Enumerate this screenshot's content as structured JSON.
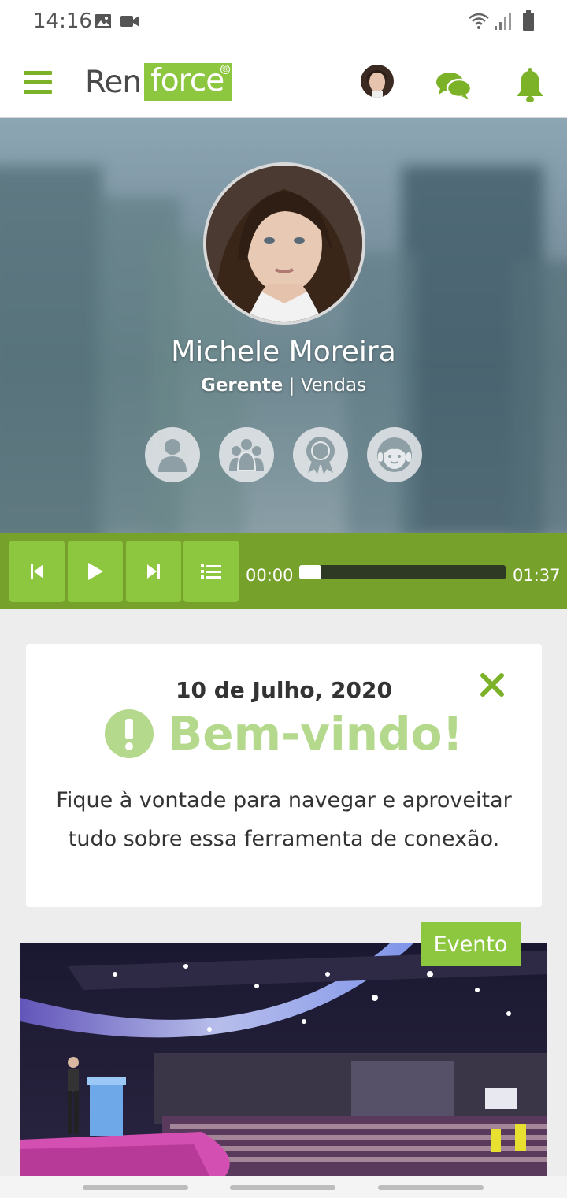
{
  "status_bar": {
    "time": "14:16",
    "icons": [
      "image-icon",
      "video-camera-icon",
      "wifi-icon",
      "signal-icon",
      "battery-icon"
    ]
  },
  "header": {
    "logo_part1": "Ren",
    "logo_part2": "force",
    "logo_mark": "®",
    "icons": [
      "menu-icon",
      "avatar",
      "chat-icon",
      "bell-icon"
    ],
    "accent_color": "#8dc63f"
  },
  "profile": {
    "name": "Michele Moreira",
    "role": "Gerente",
    "separator": "|",
    "department": "Vendas",
    "action_icons": [
      "user-icon",
      "group-icon",
      "award-icon",
      "support-agent-icon"
    ]
  },
  "player": {
    "current_time": "00:00",
    "duration": "01:37",
    "progress": 0.0,
    "controls": [
      "skip-back-icon",
      "play-icon",
      "skip-forward-icon",
      "playlist-icon"
    ]
  },
  "welcome_card": {
    "date": "10 de Julho, 2020",
    "title": "Bem-vindo!",
    "message": "Fique à vontade para navegar e aproveitar tudo sobre essa ferramenta de conexão.",
    "title_color": "#b4d98c"
  },
  "event": {
    "tag": "Evento"
  }
}
